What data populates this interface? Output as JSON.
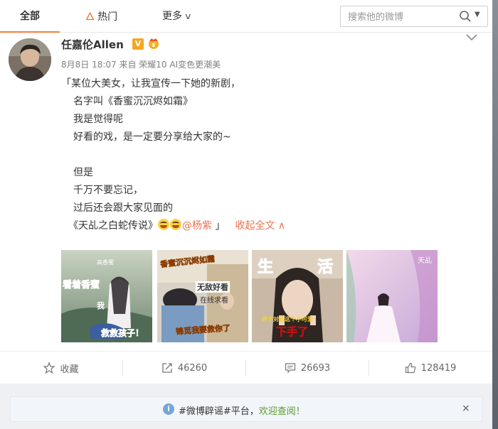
{
  "tabs": {
    "all": "全部",
    "hot": "热门",
    "more": "更多"
  },
  "search": {
    "placeholder": "搜索他的微博"
  },
  "post": {
    "username": "任嘉伦Allen",
    "verified_badge": "V",
    "meta": "8月8日 18:07 来自 荣耀10 AI变色更潮美",
    "lines": [
      "「某位大美女，让我宣传一下她的新剧，",
      "名字叫《香蜜沉沉烬如霜》",
      "我是觉得呢",
      "好看的戏，是一定要分享给大家的~",
      "",
      "但是",
      "千万不要忘记，",
      "过后还会跟大家见面的"
    ],
    "last_line_prefix": "《天乩之白蛇传说》",
    "mention": "@杨紫",
    "last_line_suffix": " 」",
    "collapse_label": "收起全文",
    "images": [
      {
        "caption_top": "看着香蜜",
        "caption_mid": "我",
        "caption_bottom": "救救孩子！",
        "tag": "高香蜜"
      },
      {
        "caption_top": "香蜜沉沉烬如霜",
        "caption_mid": "无敌好看",
        "caption_sub": "在线求看",
        "caption_bottom": "锦觅我要救你了"
      },
      {
        "caption_top_left": "生",
        "caption_top_right": "活",
        "caption_mid": "终于对我这个小可爱",
        "caption_bottom": "下手了"
      },
      {
        "caption_top": "天乩"
      }
    ]
  },
  "actions": {
    "favorite": "收藏",
    "repost": "46260",
    "comment": "26693",
    "like": "128419"
  },
  "notice": {
    "text_prefix": "#微博辟谣#平台，",
    "welcome": "欢迎查阅！",
    "close": "×"
  },
  "colors": {
    "accent": "#fa7d3c",
    "link": "#eb7350",
    "info": "#74a6d6"
  },
  "icons": {
    "hot": "flame-icon",
    "search": "search-icon",
    "favorite": "star-icon",
    "repost": "repost-icon",
    "comment": "comment-icon",
    "like": "thumbs-up-icon"
  }
}
